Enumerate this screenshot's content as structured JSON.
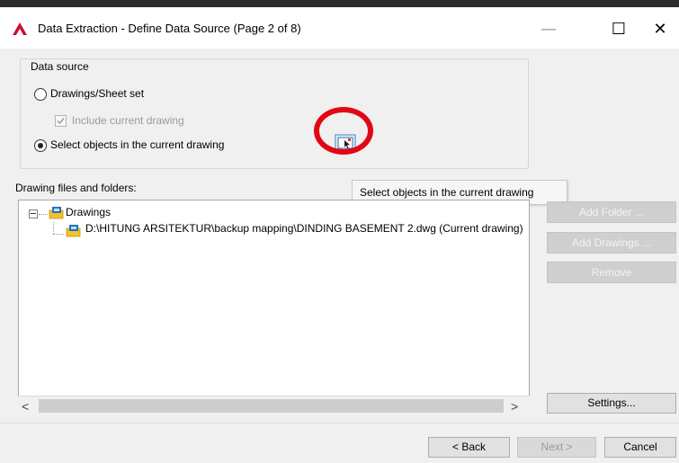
{
  "window": {
    "title": "Data Extraction - Define Data Source (Page 2 of 8)",
    "controls": {
      "minimize": "—",
      "maximize": "☐",
      "close": "✕"
    }
  },
  "data_source": {
    "group_label": "Data source",
    "option_drawings": {
      "label": "Drawings/Sheet set",
      "selected": false
    },
    "include_current": {
      "label": "Include current drawing",
      "checked": true,
      "enabled": false
    },
    "option_select_objects": {
      "label": "Select objects in the current drawing",
      "selected": true
    },
    "select_button_tooltip": "Select objects in the current drawing"
  },
  "files": {
    "label": "Drawing files and folders:",
    "tree": {
      "root": "Drawings",
      "children": [
        "D:\\HITUNG ARSITEKTUR\\backup mapping\\DINDING BASEMENT 2.dwg (Current drawing)"
      ]
    },
    "scroll_left": "<",
    "scroll_right": ">"
  },
  "side_buttons": {
    "add_folder": "Add Folder ...",
    "add_drawings": "Add Drawings ...",
    "remove": "Remove",
    "settings": "Settings..."
  },
  "footer": {
    "back": "< Back",
    "next": "Next >",
    "cancel": "Cancel"
  },
  "colors": {
    "app_icon": "#c8102e",
    "highlight_ring": "#e30613",
    "folder_blue": "#1e73be",
    "folder_yellow": "#f3c12a"
  }
}
